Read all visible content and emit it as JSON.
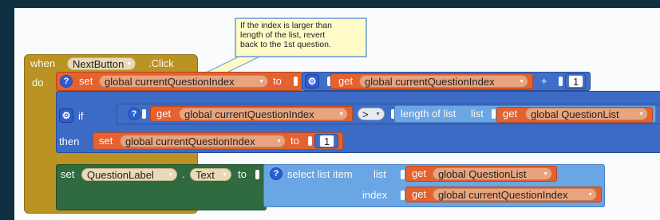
{
  "comment": {
    "lines": [
      "If the index is larger than",
      "length of the list, revert",
      "back to the 1st question."
    ]
  },
  "event_block": {
    "when_label": "when",
    "component": "NextButton",
    "event": ".Click",
    "do_label": "do"
  },
  "set_index": {
    "set_label": "set",
    "variable": "global currentQuestionIndex",
    "to_label": "to",
    "get_label": "get",
    "get_variable": "global currentQuestionIndex",
    "operator": "+",
    "amount": "1"
  },
  "if_block": {
    "if_label": "if",
    "then_label": "then",
    "get_label": "get",
    "get_variable": "global currentQuestionIndex",
    "compare_op": ">",
    "length_label": "length of list",
    "list_label": "list",
    "list_get_label": "get",
    "list_variable": "global QuestionList",
    "then_set_label": "set",
    "then_variable": "global currentQuestionIndex",
    "then_to_label": "to",
    "then_value": "1"
  },
  "set_label_block": {
    "set_label": "set",
    "component": "QuestionLabel",
    "dot": ".",
    "property": "Text",
    "to_label": "to",
    "select_label": "select list item",
    "list_label": "list",
    "list_get_label": "get",
    "list_variable": "global QuestionList",
    "index_label": "index",
    "index_get_label": "get",
    "index_variable": "global currentQuestionIndex"
  },
  "colors": {
    "event_block": "#bb9322",
    "variable_block": "#e5612f",
    "math_block": "#3f6ec8",
    "control_block": "#3c6bc6",
    "list_block": "#6ba6e4",
    "component_block": "#2f6b3e",
    "background": "#0d2f3f",
    "comment_bg": "#fffbc8"
  },
  "icons": {
    "help": "question-mark-icon",
    "mutator": "gear-mutator-icon",
    "dropdown": "triangle-down-icon"
  }
}
